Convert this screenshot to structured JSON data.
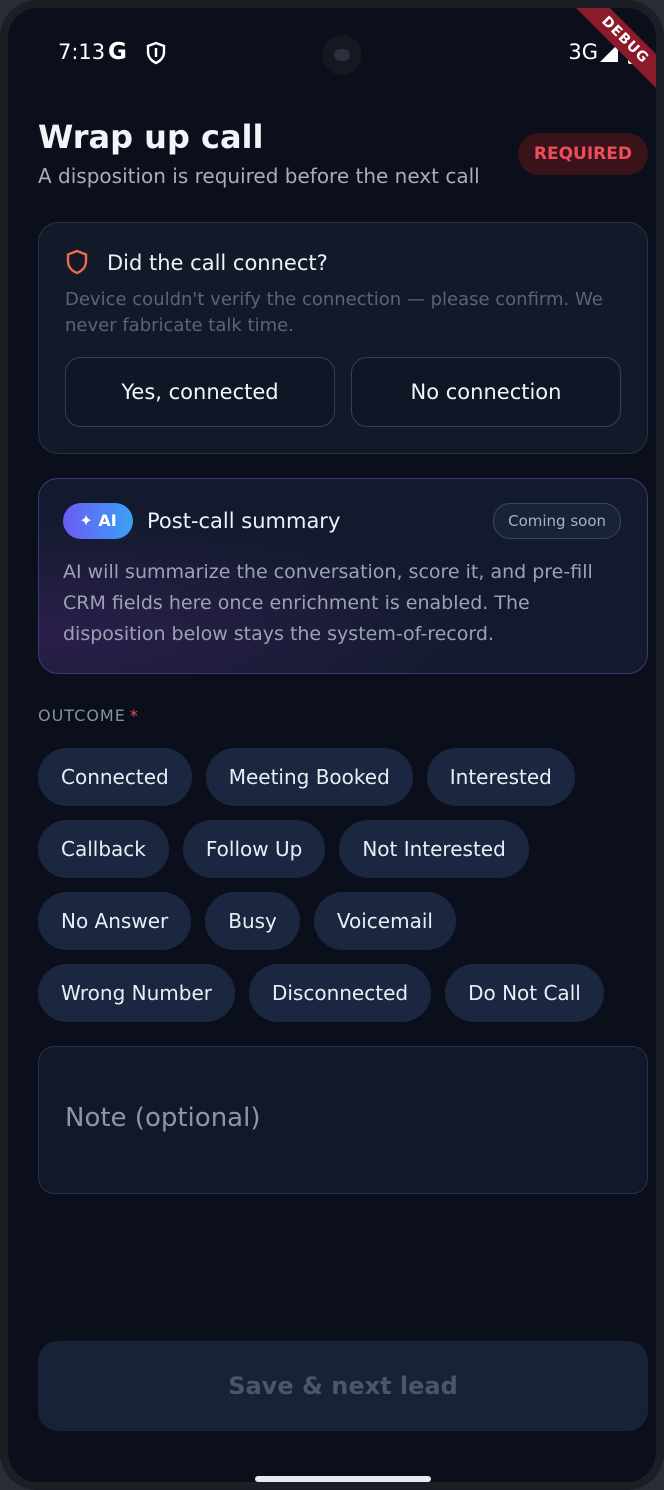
{
  "status_bar": {
    "time": "7:13",
    "g_label": "G",
    "network": "3G",
    "debug_label": "DEBUG"
  },
  "header": {
    "title": "Wrap up call",
    "subtitle": "A disposition is required before the next call",
    "required_badge": "REQUIRED"
  },
  "connect_card": {
    "icon": "shield-icon",
    "question": "Did the call connect?",
    "description": "Device couldn't verify the connection — please confirm. We never fabricate talk time.",
    "yes_label": "Yes, connected",
    "no_label": "No connection"
  },
  "summary_card": {
    "ai_badge": "AI",
    "ai_icon": "sparkle-icon",
    "title": "Post-call summary",
    "coming_soon": "Coming soon",
    "body": "AI will summarize the conversation, score it, and pre-fill CRM fields here once enrichment is enabled. The disposition below stays the system-of-record."
  },
  "outcome": {
    "label": "OUTCOME",
    "required_marker": "*",
    "options": [
      "Connected",
      "Meeting Booked",
      "Interested",
      "Callback",
      "Follow Up",
      "Not Interested",
      "No Answer",
      "Busy",
      "Voicemail",
      "Wrong Number",
      "Disconnected",
      "Do Not Call"
    ]
  },
  "note": {
    "placeholder": "Note (optional)",
    "value": ""
  },
  "actions": {
    "save_label": "Save & next lead"
  },
  "colors": {
    "background": "#0a0f1b",
    "accent_red": "#ef4c5c",
    "chip_bg": "#1b2740",
    "ai_gradient_start": "#6b5cf6",
    "ai_gradient_end": "#3aa0f4"
  }
}
